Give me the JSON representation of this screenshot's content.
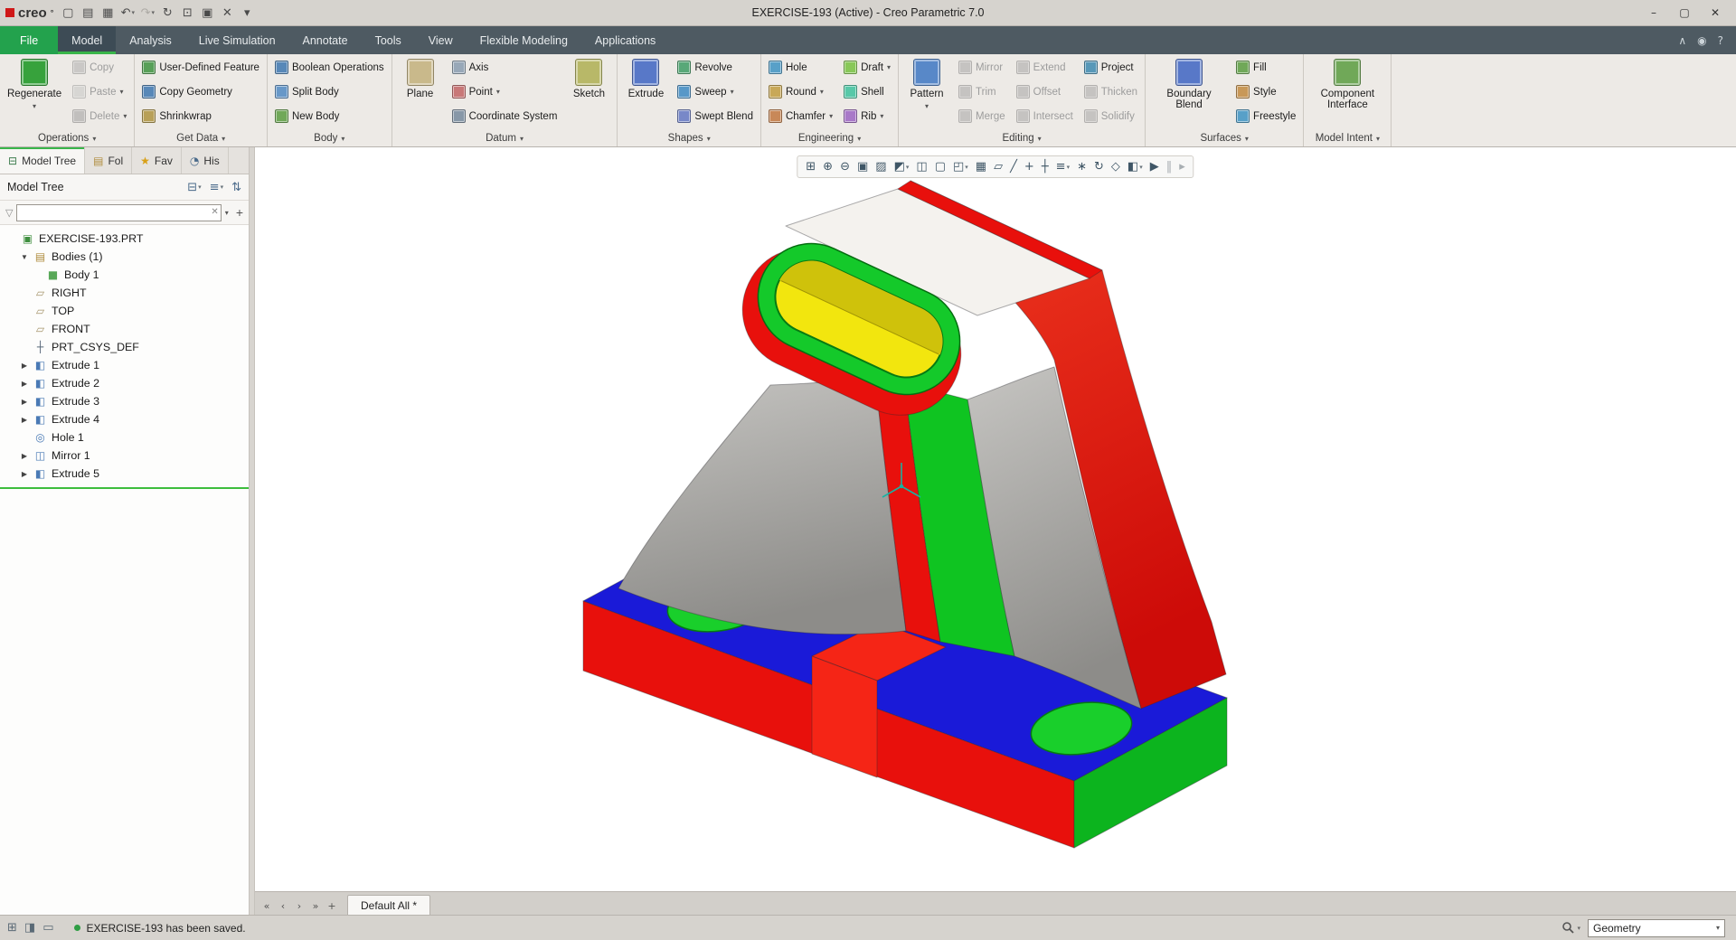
{
  "colors": {
    "accent_green": "#39b54a",
    "file_tab": "#23a24d",
    "tabbar_bg": "#4e5a62",
    "titlebar_bg": "#d6d3ce",
    "ribbon_bg": "#edeae6",
    "status_bg": "#d6d3ce",
    "model_red": "#e8100c",
    "model_green": "#0fc421",
    "model_blue": "#1a1ad8",
    "model_yellow": "#f2e60e",
    "model_yellow_dark": "#cfc20b",
    "model_white": "#f4f2ee",
    "insertion_line": "#3dbd3d"
  },
  "ui": {
    "caret_glyph": "▾",
    "expander_open": "▼",
    "expander_closed": "▶"
  },
  "title_bar": {
    "logo": "creo",
    "logo_mark": "°",
    "title": "EXERCISE-193 (Active) - Creo Parametric 7.0",
    "quick_access": [
      {
        "name": "new-file",
        "glyph": "▢"
      },
      {
        "name": "open-file",
        "glyph": "▤"
      },
      {
        "name": "save",
        "glyph": "▦"
      },
      {
        "name": "undo",
        "glyph": "↶",
        "caret": true
      },
      {
        "name": "redo",
        "glyph": "↷",
        "caret": true,
        "disabled": true
      },
      {
        "name": "regenerate-quick",
        "glyph": "↻"
      },
      {
        "name": "screen-capture",
        "glyph": "⊡"
      },
      {
        "name": "window-arrange",
        "glyph": "▣"
      },
      {
        "name": "close-window",
        "glyph": "✕"
      },
      {
        "name": "customize-quick-access",
        "glyph": "▾"
      }
    ],
    "window_controls": [
      {
        "name": "minimize-button",
        "glyph": "–"
      },
      {
        "name": "maximize-button",
        "glyph": "▢"
      },
      {
        "name": "close-button",
        "glyph": "✕"
      }
    ]
  },
  "ribbon": {
    "tabs": [
      {
        "label": "File",
        "kind": "file"
      },
      {
        "label": "Model",
        "active": true
      },
      {
        "label": "Analysis"
      },
      {
        "label": "Live Simulation"
      },
      {
        "label": "Annotate"
      },
      {
        "label": "Tools"
      },
      {
        "label": "View"
      },
      {
        "label": "Flexible Modeling"
      },
      {
        "label": "Applications"
      }
    ],
    "right_icons": [
      {
        "name": "minimize-ribbon",
        "glyph": "∧"
      },
      {
        "name": "user-account",
        "glyph": "◉"
      },
      {
        "name": "help",
        "glyph": "?"
      }
    ],
    "groups": [
      {
        "label": "Operations",
        "items": [
          {
            "big": {
              "name": "regenerate",
              "label": "Regenerate",
              "icon": "#37a23c",
              "caret": true
            }
          },
          {
            "col": [
              {
                "name": "copy",
                "label": "Copy",
                "icon": "#7ba7cf",
                "enabled": false
              },
              {
                "name": "paste",
                "label": "Paste",
                "icon": "#cfc07b",
                "enabled": false,
                "caret": true
              },
              {
                "name": "delete",
                "label": "Delete",
                "icon": "#cf7b7b",
                "enabled": false,
                "caret": true
              }
            ]
          }
        ]
      },
      {
        "label": "Get Data",
        "items": [
          {
            "col": [
              {
                "name": "user-defined-feature",
                "label": "User-Defined Feature",
                "icon": "#58a058"
              },
              {
                "name": "copy-geometry",
                "label": "Copy Geometry",
                "icon": "#5888b8"
              },
              {
                "name": "shrinkwrap",
                "label": "Shrinkwrap",
                "icon": "#b8a058"
              }
            ]
          }
        ]
      },
      {
        "label": "Body",
        "items": [
          {
            "col": [
              {
                "name": "boolean-operations",
                "label": "Boolean Operations",
                "icon": "#5888b8"
              },
              {
                "name": "split-body",
                "label": "Split Body",
                "icon": "#6898c8"
              },
              {
                "name": "new-body",
                "label": "New Body",
                "icon": "#70a858"
              }
            ]
          }
        ]
      },
      {
        "label": "Datum",
        "items": [
          {
            "big": {
              "name": "plane",
              "label": "Plane",
              "icon": "#c9b98b"
            }
          },
          {
            "col": [
              {
                "name": "axis",
                "label": "Axis",
                "icon": "#98a8b8"
              },
              {
                "name": "point",
                "label": "Point",
                "icon": "#c87878",
                "caret": true
              },
              {
                "name": "coordinate-system",
                "label": "Coordinate System",
                "icon": "#8898a8"
              }
            ]
          },
          {
            "big": {
              "name": "sketch",
              "label": "Sketch",
              "icon": "#b8b868"
            }
          }
        ]
      },
      {
        "label": "Shapes",
        "items": [
          {
            "big": {
              "name": "extrude",
              "label": "Extrude",
              "icon": "#5878c8"
            }
          },
          {
            "col": [
              {
                "name": "revolve",
                "label": "Revolve",
                "icon": "#58a878"
              },
              {
                "name": "sweep",
                "label": "Sweep",
                "icon": "#5898c8",
                "caret": true
              },
              {
                "name": "swept-blend",
                "label": "Swept Blend",
                "icon": "#7888c8"
              }
            ]
          }
        ]
      },
      {
        "label": "Engineering",
        "items": [
          {
            "col": [
              {
                "name": "hole",
                "label": "Hole",
                "icon": "#58a0c8"
              },
              {
                "name": "round",
                "label": "Round",
                "icon": "#c8a858",
                "caret": true
              },
              {
                "name": "chamfer",
                "label": "Chamfer",
                "icon": "#c88858",
                "caret": true
              }
            ]
          },
          {
            "col": [
              {
                "name": "draft",
                "label": "Draft",
                "icon": "#88c858",
                "caret": true
              },
              {
                "name": "shell",
                "label": "Shell",
                "icon": "#58c8a8"
              },
              {
                "name": "rib",
                "label": "Rib",
                "icon": "#a878c8",
                "caret": true
              }
            ]
          }
        ]
      },
      {
        "label": "Editing",
        "items": [
          {
            "big": {
              "name": "pattern",
              "label": "Pattern",
              "icon": "#5888c8",
              "caret": true
            }
          },
          {
            "col": [
              {
                "name": "mirror",
                "label": "Mirror",
                "icon": "#8898a8",
                "enabled": false
              },
              {
                "name": "trim",
                "label": "Trim",
                "icon": "#8898a8",
                "enabled": false
              },
              {
                "name": "merge",
                "label": "Merge",
                "icon": "#8898a8",
                "enabled": false
              }
            ]
          },
          {
            "col": [
              {
                "name": "extend",
                "label": "Extend",
                "icon": "#8898a8",
                "enabled": false
              },
              {
                "name": "offset",
                "label": "Offset",
                "icon": "#8898a8",
                "enabled": false
              },
              {
                "name": "intersect",
                "label": "Intersect",
                "icon": "#8898a8",
                "enabled": false
              }
            ]
          },
          {
            "col": [
              {
                "name": "project",
                "label": "Project",
                "icon": "#5898b8"
              },
              {
                "name": "thicken",
                "label": "Thicken",
                "icon": "#8898a8",
                "enabled": false
              },
              {
                "name": "solidify",
                "label": "Solidify",
                "icon": "#8898a8",
                "enabled": false
              }
            ]
          }
        ]
      },
      {
        "label": "Surfaces",
        "items": [
          {
            "big": {
              "name": "boundary-blend",
              "label": "Boundary Blend",
              "icon": "#5878c8"
            }
          },
          {
            "col": [
              {
                "name": "fill",
                "label": "Fill",
                "icon": "#70a858"
              },
              {
                "name": "style",
                "label": "Style",
                "icon": "#c89858"
              },
              {
                "name": "freestyle",
                "label": "Freestyle",
                "icon": "#58a0c8"
              }
            ]
          }
        ]
      },
      {
        "label": "Model Intent",
        "items": [
          {
            "big": {
              "name": "component-interface",
              "label": "Component Interface",
              "icon": "#70a858"
            }
          }
        ]
      }
    ]
  },
  "graphics_toolbar": {
    "icons": [
      {
        "name": "zoom-region",
        "glyph": "⊞"
      },
      {
        "name": "zoom-in",
        "glyph": "⊕"
      },
      {
        "name": "zoom-out",
        "glyph": "⊖"
      },
      {
        "name": "refit",
        "glyph": "▣"
      },
      {
        "name": "repaint",
        "glyph": "▨"
      },
      {
        "name": "display-style",
        "glyph": "◩",
        "caret": true
      },
      {
        "name": "show-edges",
        "glyph": "◫"
      },
      {
        "name": "transparency",
        "glyph": "▢"
      },
      {
        "name": "saved-orientations",
        "glyph": "◰",
        "caret": true
      },
      {
        "name": "view-manager",
        "glyph": "▦"
      },
      {
        "name": "plane-display",
        "glyph": "▱"
      },
      {
        "name": "axis-display",
        "glyph": "╱"
      },
      {
        "name": "point-display",
        "glyph": "+"
      },
      {
        "name": "csys-display",
        "glyph": "┼"
      },
      {
        "name": "annotation-display",
        "glyph": "≡",
        "caret": true
      },
      {
        "name": "spin-center",
        "glyph": "∗"
      },
      {
        "name": "orient-mode",
        "glyph": "↻"
      },
      {
        "name": "perspective",
        "glyph": "◇"
      },
      {
        "name": "section",
        "glyph": "◧",
        "caret": true
      },
      {
        "name": "realtime-simulation",
        "glyph": "▶"
      },
      {
        "name": "pause",
        "glyph": "‖",
        "disabled": true
      },
      {
        "name": "step-forward",
        "glyph": "▸",
        "disabled": true
      }
    ]
  },
  "model_tree": {
    "panel_tabs": [
      {
        "name": "tab-model-tree",
        "label": "Model Tree",
        "icon": "⊟",
        "icon_color": "#3f7d4f",
        "active": true
      },
      {
        "name": "tab-folder-browser",
        "label": "Fol",
        "icon": "▤",
        "icon_color": "#b08d3f"
      },
      {
        "name": "tab-favorites",
        "label": "Fav",
        "icon": "★",
        "icon_color": "#d8a017"
      },
      {
        "name": "tab-history",
        "label": "His",
        "icon": "◔",
        "icon_color": "#4a6a8a"
      }
    ],
    "header_label": "Model Tree",
    "header_icons": [
      {
        "name": "tree-columns",
        "glyph": "⊟",
        "caret": true
      },
      {
        "name": "tree-settings",
        "glyph": "≡",
        "caret": true
      },
      {
        "name": "tree-expand-collapse",
        "glyph": "⇅"
      }
    ],
    "filter": {
      "funnel": "▽",
      "clear": "✕",
      "caret": "▾",
      "add": "+"
    },
    "icon_map": {
      "part": {
        "glyph": "▣",
        "color": "#3f8f3f"
      },
      "folder": {
        "glyph": "▤",
        "color": "#b08d3f"
      },
      "body": {
        "glyph": "■",
        "color": "#58a858"
      },
      "plane": {
        "glyph": "▱",
        "color": "#a5946a"
      },
      "csys": {
        "glyph": "┼",
        "color": "#5a6a7a"
      },
      "extrude": {
        "glyph": "◧",
        "color": "#4a7ab5"
      },
      "hole": {
        "glyph": "◎",
        "color": "#4a7ab5"
      },
      "mirror": {
        "glyph": "◫",
        "color": "#4a7ab5"
      }
    },
    "items": [
      {
        "label": "EXERCISE-193.PRT",
        "level": 0,
        "icon": "part",
        "exp": null
      },
      {
        "label": "Bodies (1)",
        "level": 1,
        "icon": "folder",
        "exp": "open"
      },
      {
        "label": "Body 1",
        "level": 2,
        "icon": "body",
        "exp": null
      },
      {
        "label": "RIGHT",
        "level": 1,
        "icon": "plane",
        "exp": null
      },
      {
        "label": "TOP",
        "level": 1,
        "icon": "plane",
        "exp": null
      },
      {
        "label": "FRONT",
        "level": 1,
        "icon": "plane",
        "exp": null
      },
      {
        "label": "PRT_CSYS_DEF",
        "level": 1,
        "icon": "csys",
        "exp": null
      },
      {
        "label": "Extrude 1",
        "level": 1,
        "icon": "extrude",
        "exp": "closed"
      },
      {
        "label": "Extrude 2",
        "level": 1,
        "icon": "extrude",
        "exp": "closed"
      },
      {
        "label": "Extrude 3",
        "level": 1,
        "icon": "extrude",
        "exp": "closed"
      },
      {
        "label": "Extrude 4",
        "level": 1,
        "icon": "extrude",
        "exp": "closed"
      },
      {
        "label": "Hole 1",
        "level": 1,
        "icon": "hole",
        "exp": null
      },
      {
        "label": "Mirror 1",
        "level": 1,
        "icon": "mirror",
        "exp": "closed"
      },
      {
        "label": "Extrude 5",
        "level": 1,
        "icon": "extrude",
        "exp": "closed"
      }
    ]
  },
  "viewport": {
    "active_tab": "Default All *",
    "nav": [
      {
        "name": "first-view-tab",
        "glyph": "«"
      },
      {
        "name": "prev-view-tab",
        "glyph": "‹"
      },
      {
        "name": "next-view-tab",
        "glyph": "›"
      },
      {
        "name": "last-view-tab",
        "glyph": "»"
      },
      {
        "name": "new-view-tab",
        "glyph": "+"
      }
    ]
  },
  "status_bar": {
    "icons": [
      {
        "name": "model-tree-sash-toggle",
        "glyph": "⊞"
      },
      {
        "name": "browser-sash-toggle",
        "glyph": "◨"
      },
      {
        "name": "full-window-toggle",
        "glyph": "▭"
      }
    ],
    "message": "EXERCISE-193 has been saved.",
    "selection_filter": "Geometry"
  }
}
